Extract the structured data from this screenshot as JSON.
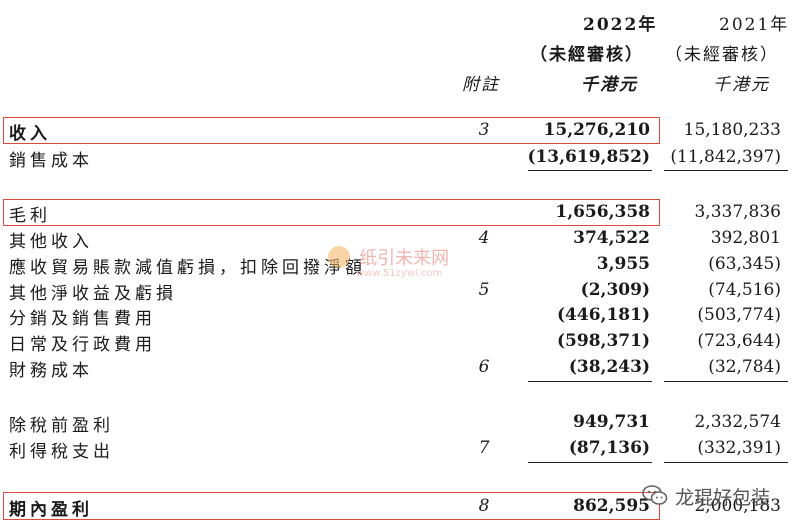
{
  "header": {
    "year_2022": "2022年",
    "unaudited_2022": "（未經審核）",
    "unit_2022": "千港元",
    "year_2021": "2021年",
    "unaudited_2021": "（未經審核）",
    "unit_2021": "千港元",
    "notes_label": "附註"
  },
  "rows": [
    {
      "label": "收入",
      "note": "3",
      "v2022": "15,276,210",
      "v2021": "15,180,233"
    },
    {
      "label": "銷售成本",
      "note": "",
      "v2022": "(13,619,852)",
      "v2021": "(11,842,397)"
    },
    {
      "label": "毛利",
      "note": "",
      "v2022": "1,656,358",
      "v2021": "3,337,836"
    },
    {
      "label": "其他收入",
      "note": "4",
      "v2022": "374,522",
      "v2021": "392,801"
    },
    {
      "label": "應收貿易賬款減值虧損，扣除回撥淨額",
      "note": "",
      "v2022": "3,955",
      "v2021": "(63,345)"
    },
    {
      "label": "其他淨收益及虧損",
      "note": "5",
      "v2022": "(2,309)",
      "v2021": "(74,516)"
    },
    {
      "label": "分銷及銷售費用",
      "note": "",
      "v2022": "(446,181)",
      "v2021": "(503,774)"
    },
    {
      "label": "日常及行政費用",
      "note": "",
      "v2022": "(598,371)",
      "v2021": "(723,644)"
    },
    {
      "label": "財務成本",
      "note": "6",
      "v2022": "(38,243)",
      "v2021": "(32,784)"
    },
    {
      "label": "除稅前盈利",
      "note": "",
      "v2022": "949,731",
      "v2021": "2,332,574"
    },
    {
      "label": "利得稅支出",
      "note": "7",
      "v2022": "(87,136)",
      "v2021": "(332,391)"
    },
    {
      "label": "期內盈利",
      "note": "8",
      "v2022": "862,595",
      "v2021": "2,000,183"
    }
  ],
  "watermark": {
    "text": "纸引未来网",
    "sub": "www.51zywl.com"
  },
  "wechat_badge": {
    "text": "龙琨好包装"
  },
  "colors": {
    "highlight": "#e0473d",
    "text": "#1a1a1a"
  }
}
